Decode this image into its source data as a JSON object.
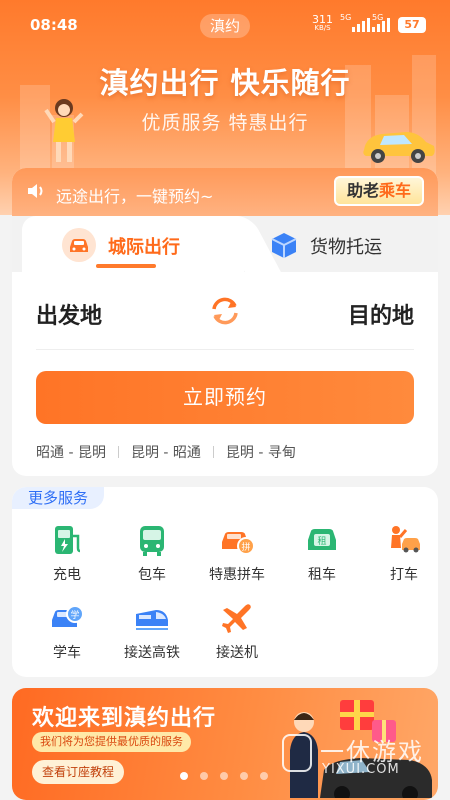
{
  "status_bar": {
    "time": "08:48",
    "app_name": "滇约",
    "net_speed_value": "311",
    "net_speed_unit": "KB/S",
    "signal1_tag": "5G",
    "signal2_tag": "5G",
    "battery": "57"
  },
  "hero": {
    "slogan": "滇约出行 快乐随行",
    "subtitle": "优质服务 特惠出行"
  },
  "notice": {
    "text": "远途出行，一键预约~",
    "elder_mode_prefix": "助老",
    "elder_mode_suffix": "乘车"
  },
  "tabs": [
    {
      "label": "城际出行",
      "active": true,
      "icon": "car-icon"
    },
    {
      "label": "货物托运",
      "active": false,
      "icon": "box-icon"
    }
  ],
  "trip": {
    "from": "出发地",
    "to": "目的地",
    "book_button": "立即预约",
    "routes": [
      "昭通 - 昆明",
      "昆明 - 昭通",
      "昆明 - 寻甸"
    ]
  },
  "services": {
    "title": "更多服务",
    "items": [
      {
        "label": "充电",
        "icon": "charging-station-icon"
      },
      {
        "label": "包车",
        "icon": "bus-icon"
      },
      {
        "label": "特惠拼车",
        "icon": "carpool-icon"
      },
      {
        "label": "租车",
        "icon": "rent-car-icon"
      },
      {
        "label": "打车",
        "icon": "hail-taxi-icon"
      },
      {
        "label": "学车",
        "icon": "driving-school-icon"
      },
      {
        "label": "接送高铁",
        "icon": "high-speed-train-icon"
      },
      {
        "label": "接送机",
        "icon": "airplane-icon"
      }
    ]
  },
  "banner": {
    "title": "欢迎来到滇约出行",
    "subtitle": "我们将为您提供最优质的服务",
    "button": "查看订座教程",
    "page_count": 5,
    "active_page": 1
  },
  "watermark": {
    "text": "一休游戏",
    "url": "YIXUI.COM"
  },
  "colors": {
    "accent": "#ff7426",
    "link_blue": "#2f6ff5",
    "service_green": "#2bb673"
  }
}
